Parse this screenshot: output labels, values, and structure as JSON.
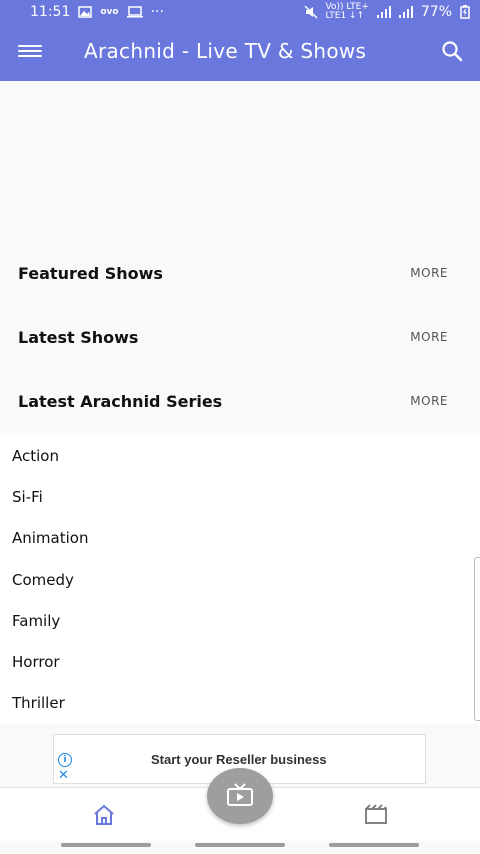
{
  "status_bar": {
    "time": "11:51",
    "carrier_icons": "ovo",
    "more": "···",
    "network_top": "Vo)) LTE+",
    "network_bottom": "LTE1 ↓↑",
    "battery": "77%"
  },
  "app_bar": {
    "title": "Arachnid - Live TV & Shows"
  },
  "sections": [
    {
      "title": "Featured Shows",
      "more": "MORE"
    },
    {
      "title": "Latest Shows",
      "more": "MORE"
    },
    {
      "title": "Latest Arachnid Series",
      "more": "MORE"
    }
  ],
  "genres": [
    "Action",
    "Si-Fi",
    "Animation",
    "Comedy",
    "Family",
    "Horror",
    "Thriller"
  ],
  "ad": {
    "text": "Start your Reseller business"
  },
  "bottom_nav": {
    "items": [
      "home-icon",
      "live-tv-icon",
      "movies-icon"
    ]
  },
  "colors": {
    "primary": "#6a78de",
    "fab": "#9e9e9e",
    "nav_icon": "#6a78de"
  }
}
